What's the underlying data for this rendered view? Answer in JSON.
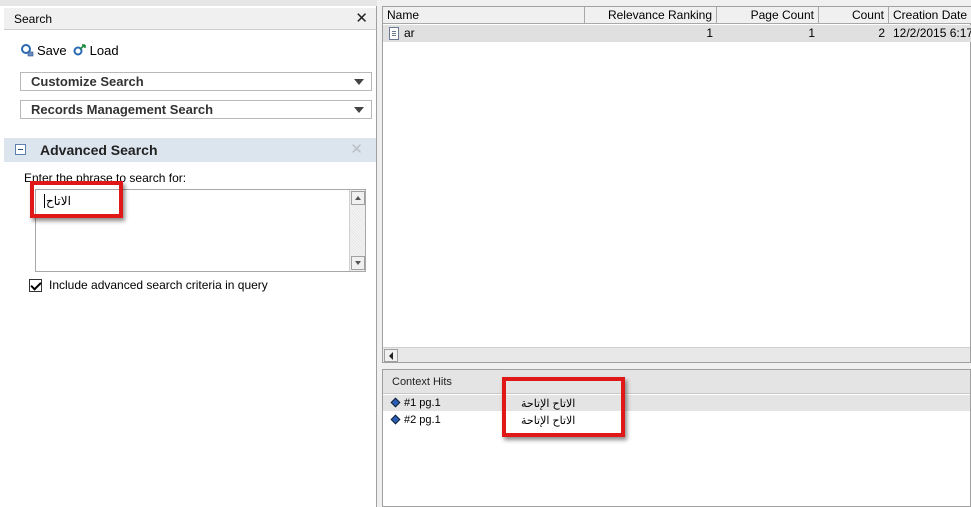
{
  "search_panel": {
    "title": "Search",
    "close_glyph": "✕",
    "toolbar": {
      "save_label": "Save",
      "load_label": "Load",
      "save_icon": "save-search-icon",
      "load_icon": "load-search-icon"
    },
    "dropdowns": [
      {
        "label": "Customize Search"
      },
      {
        "label": "Records Management Search"
      }
    ],
    "advanced": {
      "title": "Advanced Search",
      "close_glyph": "✕",
      "phrase_label": "Enter the phrase to search for:",
      "phrase_value": "الاتاح",
      "include_label": "Include advanced search criteria in query",
      "include_checked": true
    }
  },
  "results": {
    "columns": [
      "Name",
      "Relevance Ranking",
      "Page Count",
      "Count",
      "Creation Date"
    ],
    "rows": [
      {
        "name": "ar",
        "relevance": "1",
        "page_count": "1",
        "count": "2",
        "creation_date": "12/2/2015 6:17"
      }
    ]
  },
  "context_hits": {
    "title": "Context Hits",
    "hits": [
      {
        "label": "#1 pg.1",
        "snippet": "الاتاح   الإتاحة"
      },
      {
        "label": "#2 pg.1",
        "snippet": "الاتاح   الإتاحة"
      }
    ]
  },
  "colors": {
    "highlight_red": "#e01818",
    "advanced_header_bg": "#dce4ee",
    "selected_row_bg": "#e0e0e0",
    "hit_diamond": "#2b5fb5"
  }
}
